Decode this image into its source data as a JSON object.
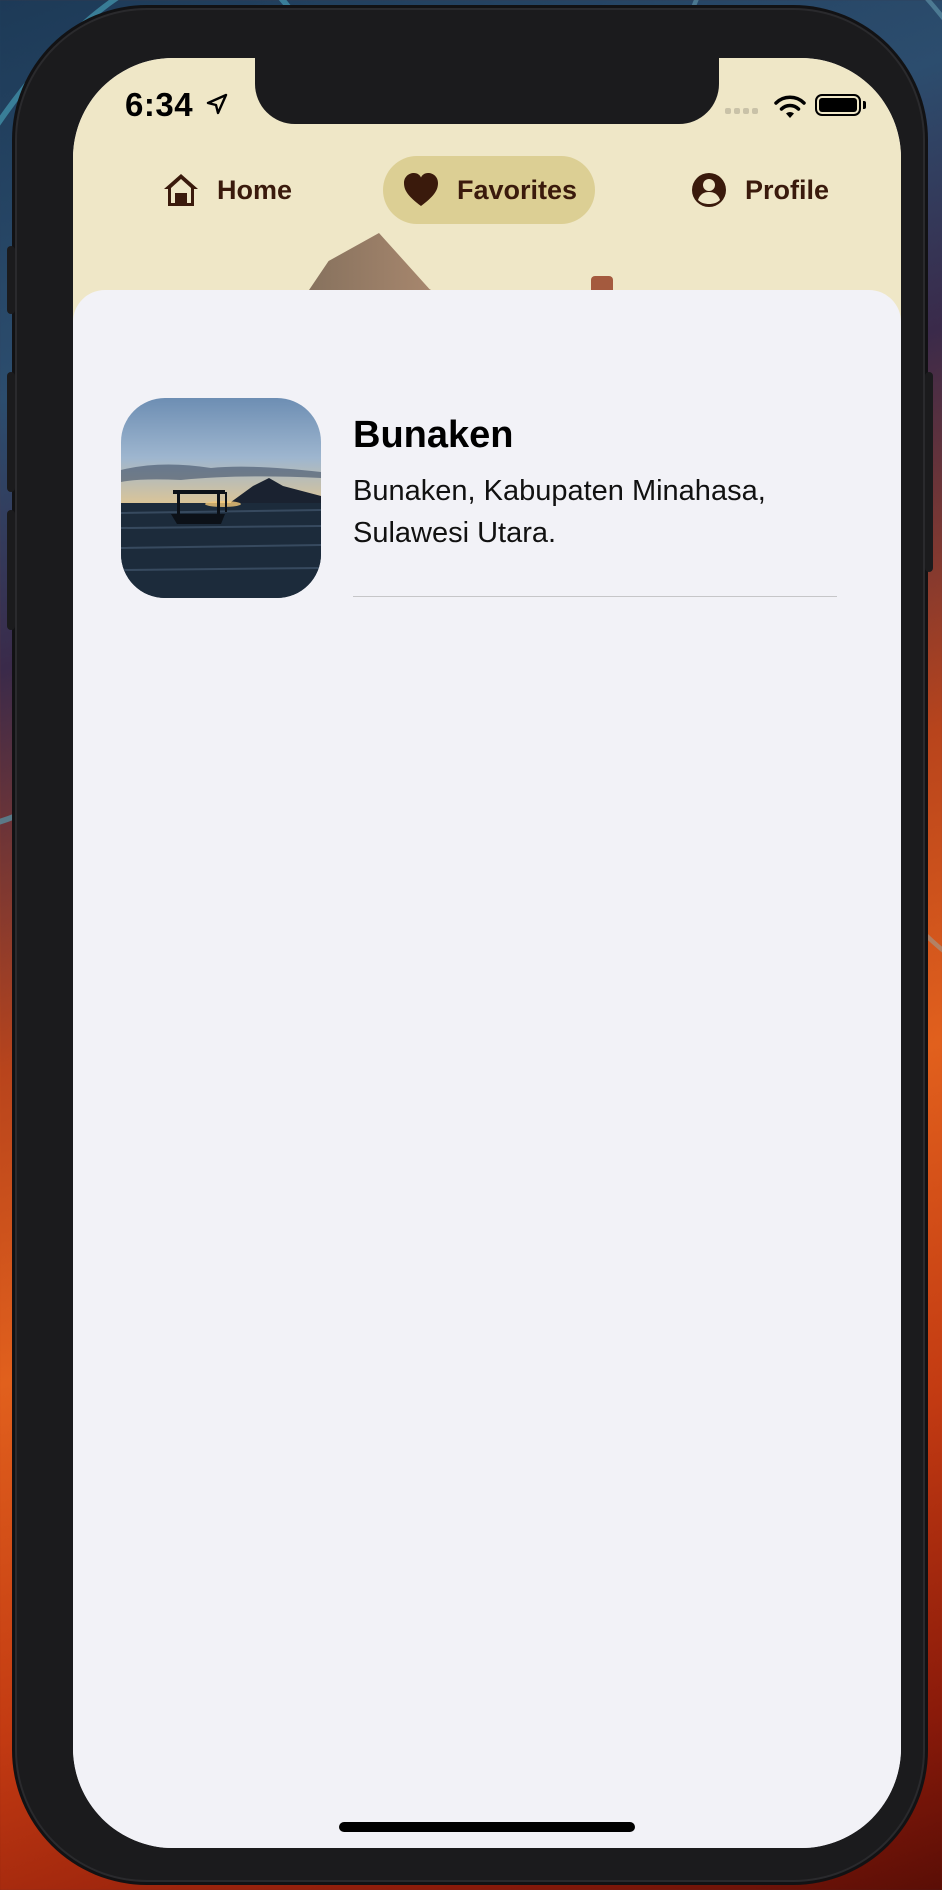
{
  "status_bar": {
    "time": "6:34",
    "location_icon": "location-arrow-icon",
    "wifi_icon": "wifi-icon",
    "battery_icon": "battery-icon"
  },
  "tabs": [
    {
      "label": "Home",
      "icon": "house-icon",
      "selected": false
    },
    {
      "label": "Favorites",
      "icon": "heart-icon",
      "selected": true
    },
    {
      "label": "Profile",
      "icon": "person-circle-icon",
      "selected": false
    }
  ],
  "colors": {
    "tab_text": "#3a1a0c",
    "tab_selected_bg": "#dccf94",
    "header_bg": "#efe7c7",
    "content_bg": "#f2f2f7"
  },
  "favorites": [
    {
      "title": "Bunaken",
      "subtitle": "Bunaken, Kabupaten Minahasa, Sulawesi Utara."
    }
  ]
}
